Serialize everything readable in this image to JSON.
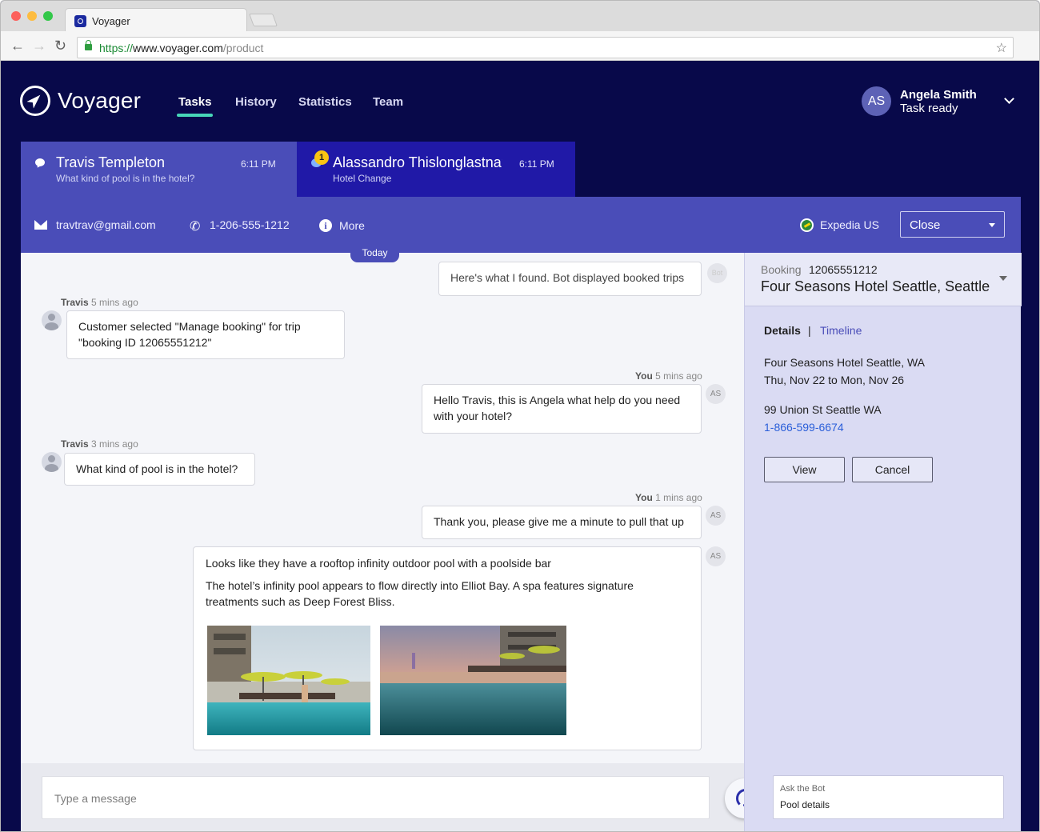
{
  "browser": {
    "tab_title": "Voyager",
    "url_scheme": "https://",
    "url_host": "www.voyager.com",
    "url_path": "/product"
  },
  "app": {
    "logo_text": "Voyager",
    "nav": [
      "Tasks",
      "History",
      "Statistics",
      "Team"
    ],
    "active_nav": "Tasks",
    "user": {
      "initials": "AS",
      "name": "Angela Smith",
      "status": "Task ready"
    }
  },
  "conversations": [
    {
      "name": "Travis Templeton",
      "preview": "What kind of pool is in the hotel?",
      "time": "6:11 PM"
    },
    {
      "name": "Alassandro Thislonglastname",
      "preview": "Hotel Change",
      "time": "6:11 PM",
      "badge": "1"
    }
  ],
  "contact": {
    "email": "travtrav@gmail.com",
    "phone": "1-206-555-1212",
    "more_label": "More",
    "site": "Expedia US",
    "status_select": "Close"
  },
  "chat": {
    "day_label": "Today",
    "bot_avatar": "Bot",
    "agent_avatar": "AS",
    "messages": {
      "bot1": "Here's what I found. Bot displayed booked trips",
      "c1_author": "Travis",
      "c1_time": "5 mins ago",
      "c1_text": "Customer selected \"Manage booking\" for trip \"booking ID 12065551212\"",
      "a1_author": "You",
      "a1_time": "5 mins ago",
      "a1_text": "Hello Travis, this is Angela what help do you need with your hotel?",
      "c2_author": "Travis",
      "c2_time": "3 mins ago",
      "c2_text": "What kind of pool is in the hotel?",
      "a2_author": "You",
      "a2_time": "1 mins ago",
      "a2_text": "Thank you, please give me a minute to pull that up",
      "a3_line1": "Looks like they have a rooftop infinity outdoor pool with a poolside bar",
      "a3_line2": "The hotel’s infinity pool appears to flow directly into Elliot Bay. A spa features signature treatments such as Deep Forest Bliss."
    },
    "composer_placeholder": "Type a message"
  },
  "booking": {
    "label": "Booking",
    "number": "12065551212",
    "title": "Four Seasons Hotel Seattle, Seattle",
    "tab_details": "Details",
    "tab_sep": "|",
    "tab_timeline": "Timeline",
    "hotel": "Four Seasons Hotel Seattle, WA",
    "dates": "Thu, Nov 22 to Mon, Nov 26",
    "address": "99 Union St Seattle WA",
    "phone": "1-866-599-6674",
    "view_label": "View",
    "cancel_label": "Cancel"
  },
  "bot_query": {
    "label": "Ask the Bot",
    "value": "Pool details"
  },
  "colors": {
    "app_bg": "#08094a",
    "tab_active": "#4a4db8",
    "tab_inactive": "#2019a7",
    "accent": "#47d6b8",
    "panel": "#dadbf3"
  }
}
